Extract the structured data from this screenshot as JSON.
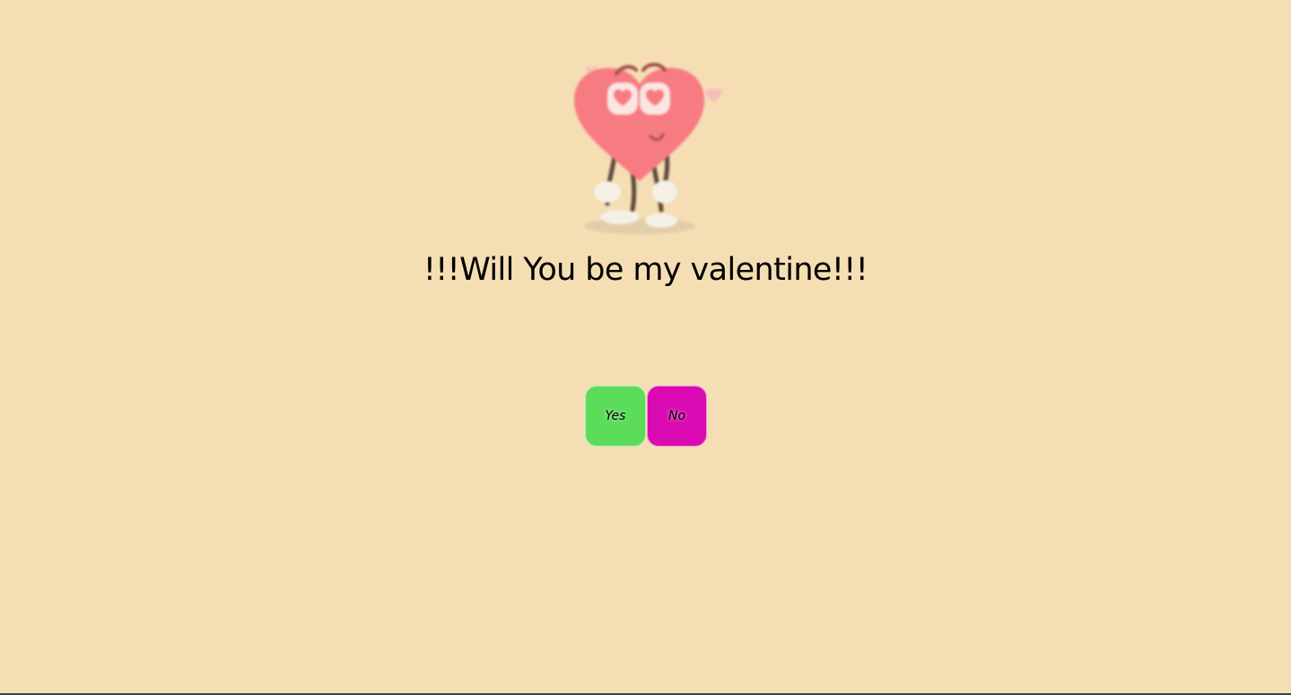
{
  "page": {
    "background_color": "#f5deb3",
    "bottom_bar_color": "#2c4a46"
  },
  "illustration": {
    "name": "heart-character-illustration",
    "heart_color": "#f77b82",
    "eye_heart_color": "#f77b82"
  },
  "question": {
    "text": "!!!Will You be my valentine!!!",
    "color": "#000000"
  },
  "buttons": {
    "yes": {
      "label": "Yes",
      "color": "#5bdc5b"
    },
    "no": {
      "label": "No",
      "color": "#d90ab2"
    }
  }
}
